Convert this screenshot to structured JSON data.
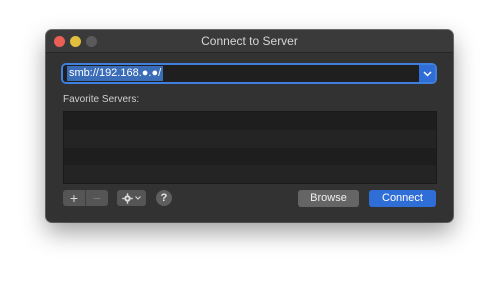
{
  "window": {
    "title": "Connect to Server"
  },
  "address": {
    "value": "smb://192.168.●.●/"
  },
  "favorites": {
    "label": "Favorite Servers:",
    "items": []
  },
  "toolbar": {
    "add_label": "+",
    "remove_label": "−",
    "help_label": "?"
  },
  "buttons": {
    "browse": "Browse",
    "connect": "Connect"
  },
  "colors": {
    "accent": "#2f6ed6",
    "window_bg": "#323232",
    "close": "#ec5f57",
    "minimize": "#e1bf3e"
  }
}
